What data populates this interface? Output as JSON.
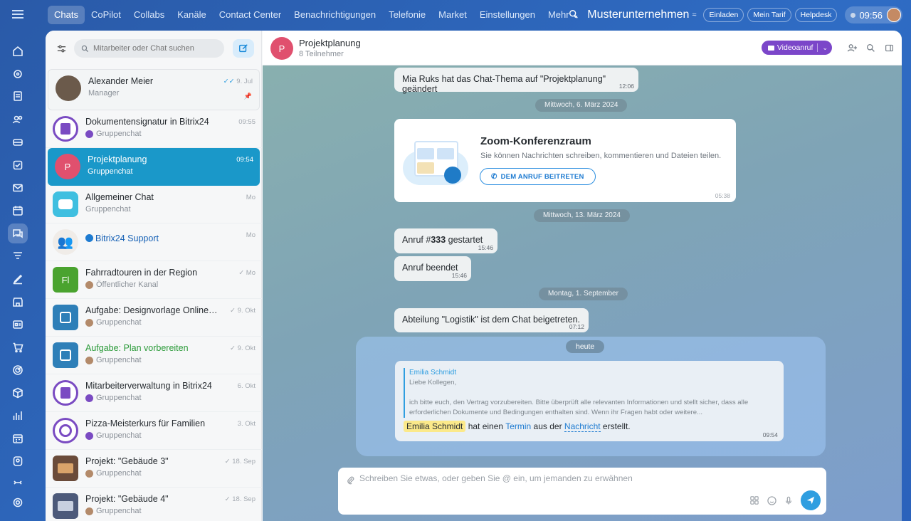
{
  "nav": {
    "tabs": [
      {
        "label": "Chats"
      },
      {
        "label": "CoPilot"
      },
      {
        "label": "Collabs"
      },
      {
        "label": "Kanäle"
      },
      {
        "label": "Contact Center"
      },
      {
        "label": "Benachrichtigungen"
      },
      {
        "label": "Telefonie"
      },
      {
        "label": "Market"
      },
      {
        "label": "Einstellungen"
      },
      {
        "label": "Mehr ⌄"
      }
    ],
    "company": "Musterunternehmen",
    "invite": "Einladen",
    "plan": "Mein Tarif",
    "helpdesk": "Helpdesk",
    "clock": "09:56"
  },
  "rail": {
    "icons": [
      "home-icon",
      "automation-icon",
      "document-icon",
      "contacts-icon",
      "crm-icon",
      "tasks-icon",
      "mail-icon",
      "calendar-icon",
      "chat-icon",
      "funnel-icon",
      "sign-icon",
      "shop-icon",
      "sites-icon",
      "cart-icon",
      "marketing-icon",
      "box-icon",
      "analytics-icon",
      "booking-icon",
      "hr-icon",
      "more-icon",
      "settings-icon"
    ]
  },
  "sidebar": {
    "search_placeholder": "Mitarbeiter oder Chat suchen",
    "chats": [
      {
        "name": "Alexander Meier",
        "sub": "Manager",
        "time": "9. Jul"
      },
      {
        "name": "Dokumentensignatur in Bitrix24",
        "sub": "Gruppenchat",
        "time": "09:55"
      },
      {
        "name": "Projektplanung",
        "sub": "Gruppenchat",
        "time": "09:54",
        "initial": "P"
      },
      {
        "name": "Allgemeiner Chat",
        "sub": "Gruppenchat",
        "time": "Mo"
      },
      {
        "name": "Bitrix24 Support",
        "sub": "",
        "time": "Mo"
      },
      {
        "name": "Fahrradtouren in der Region",
        "sub": "Öffentlicher Kanal",
        "time": "Mo",
        "initial": "Fl"
      },
      {
        "name": "Aufgabe: Designvorlage Onlinesh...",
        "sub": "Gruppenchat",
        "time": "9. Okt"
      },
      {
        "name": "Aufgabe: Plan vorbereiten",
        "sub": "Gruppenchat",
        "time": "9. Okt"
      },
      {
        "name": "Mitarbeiterverwaltung in Bitrix24",
        "sub": "Gruppenchat",
        "time": "6. Okt"
      },
      {
        "name": "Pizza-Meisterkurs für Familien",
        "sub": "Gruppenchat",
        "time": "3. Okt"
      },
      {
        "name": "Projekt: \"Gebäude 3\"",
        "sub": "Gruppenchat",
        "time": "18. Sep"
      },
      {
        "name": "Projekt: \"Gebäude 4\"",
        "sub": "Gruppenchat",
        "time": "18. Sep"
      }
    ]
  },
  "chat": {
    "title": "Projektplanung",
    "initial": "P",
    "members": "8 Teilnehmer",
    "video_label": "Videoanruf",
    "messages": {
      "topic_change": "Mia Ruks hat das Chat-Thema auf \"Projektplanung\" geändert",
      "topic_time": "12:06",
      "date1": "Mittwoch, 6. März 2024",
      "card_title": "Zoom-Konferenzraum",
      "card_sub": "Sie können Nachrichten schreiben, kommentieren und Dateien teilen.",
      "card_button": "DEM ANRUF BEITRETEN",
      "card_time": "05:38",
      "date2": "Mittwoch, 13. März 2024",
      "call_start_prefix": "Anruf #",
      "call_start_num": "333",
      "call_start_suffix": " gestartet",
      "call_start_time": "15:46",
      "call_end": "Anruf beendet",
      "call_end_time": "15:46",
      "date3": "Montag, 1. September",
      "dept_join": "Abteilung \"Logistik\" ist dem Chat beigetreten.",
      "dept_time": "07:12",
      "today": "heute",
      "quote_author": "Emilia Schmidt",
      "quote_line1": "Liebe Kollegen,",
      "quote_line2": "ich bitte euch, den Vertrag vorzubereiten. Bitte überprüft alle relevanten Informationen und stellt sicher, dass alle erforderlichen Dokumente und Bedingungen enthalten sind. Wenn ihr Fragen habt oder weitere...",
      "mention": "Emilia Schmidt",
      "text_a": " hat einen ",
      "link_termin": "Termin",
      "text_b": " aus der ",
      "link_nachricht": "Nachricht",
      "text_c": " erstellt.",
      "last_time": "09:54"
    },
    "composer_placeholder": "Schreiben Sie etwas, oder geben Sie @ ein, um jemanden zu erwähnen"
  },
  "colors": {
    "accent": "#1a98c9",
    "video": "#7b46c9",
    "mention": "#fbe98a",
    "link": "#1e7bd1"
  }
}
